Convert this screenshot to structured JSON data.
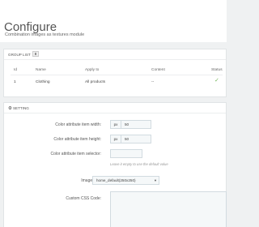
{
  "header": {
    "title": "Configure",
    "subtitle": "Combination images as textures module"
  },
  "group_list": {
    "heading": "GROUP LIST",
    "count": "8",
    "columns": [
      "Id",
      "Name",
      "Apply to",
      "Content",
      "Status"
    ],
    "rows": [
      {
        "id": "1",
        "name": "Clothing",
        "apply_to": "All products",
        "content": "--",
        "status": "enabled"
      }
    ]
  },
  "setting": {
    "heading": "SETTING",
    "width_label": "Color attribute item width:",
    "width_unit": "px",
    "width_value": "50",
    "height_label": "Color attribute item height:",
    "height_unit": "px",
    "height_value": "50",
    "selector_label": "Color attribute item selector:",
    "selector_value": "",
    "selector_help": "Leave it empty to use the default value",
    "image_type_label": "Image type",
    "image_type_value": "home_default(250x250)",
    "css_label": "Custom CSS Code:"
  },
  "icons": {
    "settings": "gear-icon",
    "status": "check-icon",
    "select": "chevron-down-icon"
  },
  "colors": {
    "status_enabled": "#74b65b",
    "background": "#eff1f2"
  }
}
